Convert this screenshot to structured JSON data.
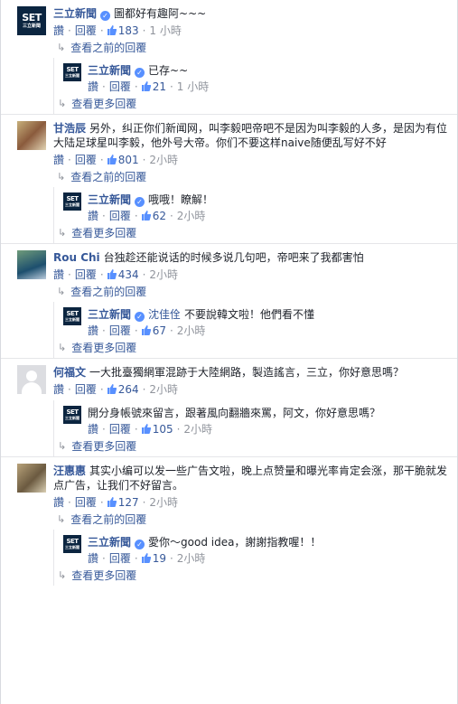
{
  "labels": {
    "like": "讚",
    "reply": "回覆",
    "sep": "·",
    "view_prev": "查看之前的回覆",
    "view_more": "查看更多回覆"
  },
  "logo": {
    "line1": "SET",
    "line2": "三立新聞"
  },
  "threads": [
    {
      "author": "三立新聞",
      "verified": true,
      "text": "圖都好有趣阿~~~",
      "likes": "183",
      "time": "1 小時",
      "reply": {
        "author": "三立新聞",
        "verified": true,
        "tag": "",
        "text": "已存~~",
        "likes": "21",
        "time": "1 小時"
      }
    },
    {
      "author": "甘浩辰",
      "verified": false,
      "text": "另外，纠正你们新闻网，叫李毅吧帝吧不是因为叫李毅的人多，是因为有位大陆足球星叫李毅，他外号大帝。你们不要这样naive随便乱写好不好",
      "likes": "801",
      "time": "2小時",
      "reply": {
        "author": "三立新聞",
        "verified": true,
        "tag": "",
        "text": "哦哦！瞭解！",
        "likes": "62",
        "time": "2小時"
      }
    },
    {
      "author": "Rou Chi",
      "verified": false,
      "text": "台独趁还能说话的时候多说几句吧，帝吧来了我都害怕",
      "likes": "434",
      "time": "2小時",
      "reply": {
        "author": "三立新聞",
        "verified": true,
        "tag": "沈佳佺",
        "text": "不要說韓文啦！他們看不懂",
        "likes": "67",
        "time": "2小時"
      }
    },
    {
      "author": "何福文",
      "verified": false,
      "text": "一大批臺獨網軍混跡于大陸網路，製造謠言，三立，你好意思嗎？",
      "likes": "264",
      "time": "2小時",
      "reply": {
        "author": "",
        "verified": false,
        "tag": "",
        "text": "開分身帳號來留言，跟著風向翻牆來罵，阿文，你好意思嗎？",
        "likes": "105",
        "time": "2小時"
      }
    },
    {
      "author": "汪惠惠",
      "verified": false,
      "text": "其实小编可以发一些广告文啦，晚上点赞量和曝光率肯定会涨，那干脆就发点广告，让我们不好留言。",
      "likes": "127",
      "time": "2小時",
      "reply": {
        "author": "三立新聞",
        "verified": true,
        "tag": "",
        "text": "愛你～good idea，謝謝指教喔！！",
        "likes": "19",
        "time": "2小時"
      }
    }
  ]
}
